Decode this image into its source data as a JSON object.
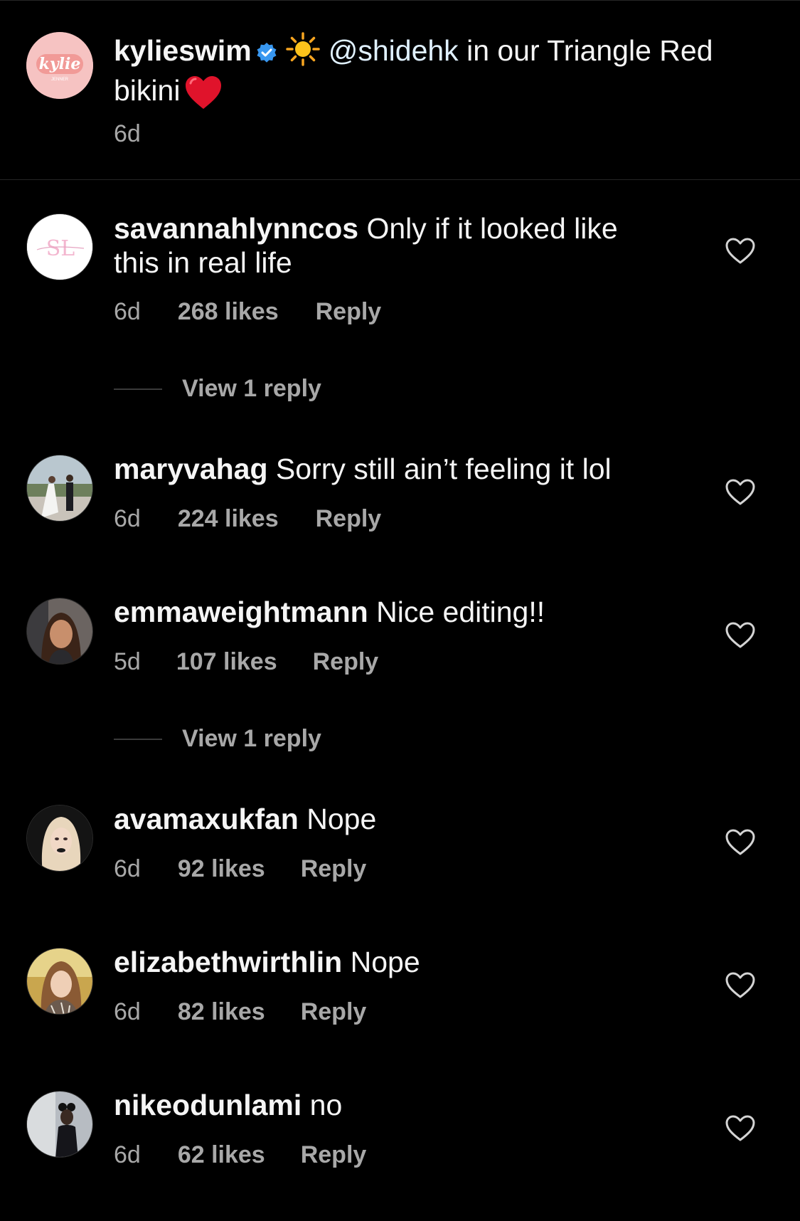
{
  "caption": {
    "username": "kylieswim",
    "avatar_text": "kylie",
    "avatar_subtext": "JENNER",
    "mention": "@shidehk",
    "text": " in our Triangle Red bikini",
    "time": "6d"
  },
  "comments": [
    {
      "username": "savannahlynncos",
      "text": "Only if it looked like this in real life",
      "time": "6d",
      "likes": "268 likes",
      "reply": "Reply",
      "view_replies": "View 1 reply",
      "avatar_text": "SL"
    },
    {
      "username": "maryvahag",
      "text": "Sorry still ain’t feeling it lol",
      "time": "6d",
      "likes": "224 likes",
      "reply": "Reply"
    },
    {
      "username": "emmaweightmann",
      "text": "Nice editing!!",
      "time": "5d",
      "likes": "107 likes",
      "reply": "Reply",
      "view_replies": "View 1 reply"
    },
    {
      "username": "avamaxukfan",
      "text": "Nope",
      "time": "6d",
      "likes": "92 likes",
      "reply": "Reply"
    },
    {
      "username": "elizabethwirthlin",
      "text": "Nope",
      "time": "6d",
      "likes": "82 likes",
      "reply": "Reply"
    },
    {
      "username": "nikeodunlami",
      "text": "no",
      "time": "6d",
      "likes": "62 likes",
      "reply": "Reply"
    }
  ],
  "colors": {
    "background": "#000000",
    "text": "#f5f5f5",
    "secondary": "#a8a8a8",
    "verified": "#3897f0",
    "heart_emoji": "#e0132b"
  },
  "icons": {
    "like": "heart-outline-icon",
    "verified": "verified-badge-icon",
    "sun": "sun-emoji",
    "heart": "red-heart-emoji"
  }
}
